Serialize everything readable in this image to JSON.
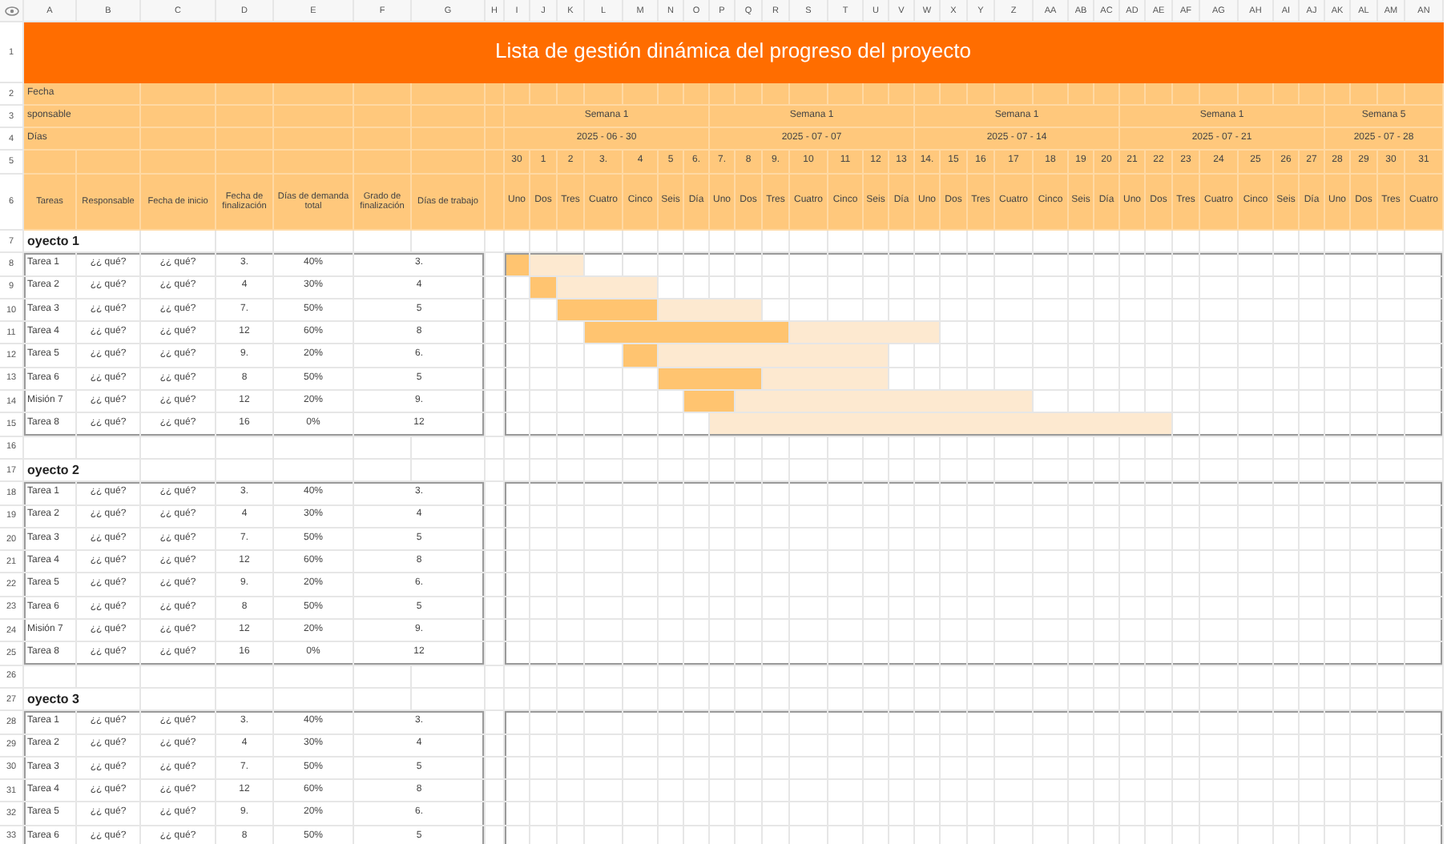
{
  "columns": [
    "A",
    "B",
    "C",
    "D",
    "E",
    "F",
    "G",
    "H",
    "I",
    "J",
    "K",
    "L",
    "M",
    "N",
    "O",
    "P",
    "Q",
    "R",
    "S",
    "T",
    "U",
    "V",
    "W",
    "X",
    "Y",
    "Z",
    "AA",
    "AB",
    "AC",
    "AD",
    "AE",
    "AF",
    "AG",
    "AH",
    "AI",
    "AJ",
    "AK",
    "AL",
    "AM",
    "AN"
  ],
  "row_numbers": [
    "1",
    "2",
    "3",
    "4",
    "5",
    "6",
    "7",
    "8",
    "9",
    "10",
    "11",
    "12",
    "13",
    "14",
    "15",
    "16",
    "17",
    "18",
    "19",
    "20",
    "21",
    "22",
    "23",
    "24",
    "25",
    "26",
    "27",
    "28",
    "29",
    "30",
    "31",
    "32",
    "33"
  ],
  "title": "Lista de gestión dinámica del progreso del proyecto",
  "labels": [
    "Fecha",
    "sponsable",
    "Días"
  ],
  "weeks": [
    {
      "label": "Semana 1",
      "date": "2025 - 06 - 30"
    },
    {
      "label": "Semana 1",
      "date": "2025 - 07 - 07"
    },
    {
      "label": "Semana 1",
      "date": "2025 - 07 - 14"
    },
    {
      "label": "Semana 1",
      "date": "2025 - 07 - 21"
    },
    {
      "label": "Semana 5",
      "date": "2025 - 07 - 28"
    }
  ],
  "days": [
    {
      "number": "30",
      "weekday": "Uno"
    },
    {
      "number": "1",
      "weekday": "Dos"
    },
    {
      "number": "2",
      "weekday": "Tres"
    },
    {
      "number": "3.",
      "weekday": "Cuatro"
    },
    {
      "number": "4",
      "weekday": "Cinco"
    },
    {
      "number": "5",
      "weekday": "Seis"
    },
    {
      "number": "6.",
      "weekday": "Día"
    },
    {
      "number": "7.",
      "weekday": "Uno"
    },
    {
      "number": "8",
      "weekday": "Dos"
    },
    {
      "number": "9.",
      "weekday": "Tres"
    },
    {
      "number": "10",
      "weekday": "Cuatro"
    },
    {
      "number": "11",
      "weekday": "Cinco"
    },
    {
      "number": "12",
      "weekday": "Seis"
    },
    {
      "number": "13",
      "weekday": "Día"
    },
    {
      "number": "14.",
      "weekday": "Uno"
    },
    {
      "number": "15",
      "weekday": "Dos"
    },
    {
      "number": "16",
      "weekday": "Tres"
    },
    {
      "number": "17",
      "weekday": "Cuatro"
    },
    {
      "number": "18",
      "weekday": "Cinco"
    },
    {
      "number": "19",
      "weekday": "Seis"
    },
    {
      "number": "20",
      "weekday": "Día"
    },
    {
      "number": "21",
      "weekday": "Uno"
    },
    {
      "number": "22",
      "weekday": "Dos"
    },
    {
      "number": "23",
      "weekday": "Tres"
    },
    {
      "number": "24",
      "weekday": "Cuatro"
    },
    {
      "number": "25",
      "weekday": "Cinco"
    },
    {
      "number": "26",
      "weekday": "Seis"
    },
    {
      "number": "27",
      "weekday": "Día"
    },
    {
      "number": "28",
      "weekday": "Uno"
    },
    {
      "number": "29",
      "weekday": "Dos"
    },
    {
      "number": "30",
      "weekday": "Tres"
    },
    {
      "number": "31",
      "weekday": "Cuatro"
    }
  ],
  "table_headers": [
    "Tareas",
    "Responsable",
    "Fecha de inicio",
    "Fecha de finalización",
    "Días de demanda total",
    "Grado de finalización",
    "Días de trabajo"
  ],
  "projects": [
    {
      "name": "oyecto 1",
      "tasks": [
        {
          "name": "Tarea 1",
          "responsible": "¿¿ qué?",
          "start": "¿¿ qué?",
          "end": "3.",
          "total": "40%",
          "workdays": "3.",
          "gantt": [
            {
              "kind": "done"
            },
            {
              "kind": "planned"
            },
            {
              "kind": "planned"
            }
          ]
        },
        {
          "name": "Tarea 2",
          "responsible": "¿¿ qué?",
          "start": "¿¿ qué?",
          "end": "4",
          "total": "30%",
          "workdays": "4",
          "gantt": [
            {
              "kind": "empty"
            },
            {
              "kind": "done"
            },
            {
              "kind": "planned"
            },
            {
              "kind": "planned"
            },
            {
              "kind": "planned"
            }
          ]
        },
        {
          "name": "Tarea 3",
          "responsible": "¿¿ qué?",
          "start": "¿¿ qué?",
          "end": "7.",
          "total": "50%",
          "workdays": "5",
          "gantt": [
            {
              "kind": "empty"
            },
            {
              "kind": "empty"
            },
            {
              "kind": "done"
            },
            {
              "kind": "done"
            },
            {
              "kind": "done"
            },
            {
              "kind": "planned"
            },
            {
              "kind": "planned"
            },
            {
              "kind": "planned"
            },
            {
              "kind": "planned"
            }
          ]
        },
        {
          "name": "Tarea 4",
          "responsible": "¿¿ qué?",
          "start": "¿¿ qué?",
          "end": "12",
          "total": "60%",
          "workdays": "8",
          "gantt": [
            {
              "kind": "empty"
            },
            {
              "kind": "empty"
            },
            {
              "kind": "empty"
            },
            {
              "kind": "done"
            },
            {
              "kind": "done"
            },
            {
              "kind": "done"
            },
            {
              "kind": "done"
            },
            {
              "kind": "done"
            },
            {
              "kind": "done"
            },
            {
              "kind": "done"
            },
            {
              "kind": "planned"
            },
            {
              "kind": "planned"
            },
            {
              "kind": "planned"
            },
            {
              "kind": "planned"
            },
            {
              "kind": "planned"
            }
          ]
        },
        {
          "name": "Tarea 5",
          "responsible": "¿¿ qué?",
          "start": "¿¿ qué?",
          "end": "9.",
          "total": "20%",
          "workdays": "6.",
          "gantt": [
            {
              "kind": "empty"
            },
            {
              "kind": "empty"
            },
            {
              "kind": "empty"
            },
            {
              "kind": "empty"
            },
            {
              "kind": "done"
            },
            {
              "kind": "planned"
            },
            {
              "kind": "planned"
            },
            {
              "kind": "planned"
            },
            {
              "kind": "planned"
            },
            {
              "kind": "planned"
            },
            {
              "kind": "planned"
            },
            {
              "kind": "planned"
            },
            {
              "kind": "planned"
            }
          ]
        },
        {
          "name": "Tarea 6",
          "responsible": "¿¿ qué?",
          "start": "¿¿ qué?",
          "end": "8",
          "total": "50%",
          "workdays": "5",
          "gantt": [
            {
              "kind": "empty"
            },
            {
              "kind": "empty"
            },
            {
              "kind": "empty"
            },
            {
              "kind": "empty"
            },
            {
              "kind": "empty"
            },
            {
              "kind": "done"
            },
            {
              "kind": "done"
            },
            {
              "kind": "done"
            },
            {
              "kind": "done"
            },
            {
              "kind": "planned"
            },
            {
              "kind": "planned"
            },
            {
              "kind": "planned"
            },
            {
              "kind": "planned"
            }
          ]
        },
        {
          "name": "Misión 7",
          "responsible": "¿¿ qué?",
          "start": "¿¿ qué?",
          "end": "12",
          "total": "20%",
          "workdays": "9.",
          "gantt": [
            {
              "kind": "empty"
            },
            {
              "kind": "empty"
            },
            {
              "kind": "empty"
            },
            {
              "kind": "empty"
            },
            {
              "kind": "empty"
            },
            {
              "kind": "empty"
            },
            {
              "kind": "done"
            },
            {
              "kind": "done"
            },
            {
              "kind": "planned"
            },
            {
              "kind": "planned"
            },
            {
              "kind": "planned"
            },
            {
              "kind": "planned"
            },
            {
              "kind": "planned"
            },
            {
              "kind": "planned"
            },
            {
              "kind": "planned"
            },
            {
              "kind": "planned"
            },
            {
              "kind": "planned"
            },
            {
              "kind": "planned"
            }
          ]
        },
        {
          "name": "Tarea 8",
          "responsible": "¿¿ qué?",
          "start": "¿¿ qué?",
          "end": "16",
          "total": "0%",
          "workdays": "12",
          "gantt": [
            {
              "kind": "empty"
            },
            {
              "kind": "empty"
            },
            {
              "kind": "empty"
            },
            {
              "kind": "empty"
            },
            {
              "kind": "empty"
            },
            {
              "kind": "empty"
            },
            {
              "kind": "empty"
            },
            {
              "kind": "planned"
            },
            {
              "kind": "planned"
            },
            {
              "kind": "planned"
            },
            {
              "kind": "planned"
            },
            {
              "kind": "planned"
            },
            {
              "kind": "planned"
            },
            {
              "kind": "planned"
            },
            {
              "kind": "planned"
            },
            {
              "kind": "planned"
            },
            {
              "kind": "planned"
            },
            {
              "kind": "planned"
            },
            {
              "kind": "planned"
            },
            {
              "kind": "planned"
            },
            {
              "kind": "planned"
            },
            {
              "kind": "planned"
            },
            {
              "kind": "planned"
            }
          ]
        }
      ]
    },
    {
      "name": "oyecto 2",
      "tasks": [
        {
          "name": "Tarea 1",
          "responsible": "¿¿ qué?",
          "start": "¿¿ qué?",
          "end": "3.",
          "total": "40%",
          "workdays": "3."
        },
        {
          "name": "Tarea 2",
          "responsible": "¿¿ qué?",
          "start": "¿¿ qué?",
          "end": "4",
          "total": "30%",
          "workdays": "4"
        },
        {
          "name": "Tarea 3",
          "responsible": "¿¿ qué?",
          "start": "¿¿ qué?",
          "end": "7.",
          "total": "50%",
          "workdays": "5"
        },
        {
          "name": "Tarea 4",
          "responsible": "¿¿ qué?",
          "start": "¿¿ qué?",
          "end": "12",
          "total": "60%",
          "workdays": "8"
        },
        {
          "name": "Tarea 5",
          "responsible": "¿¿ qué?",
          "start": "¿¿ qué?",
          "end": "9.",
          "total": "20%",
          "workdays": "6."
        },
        {
          "name": "Tarea 6",
          "responsible": "¿¿ qué?",
          "start": "¿¿ qué?",
          "end": "8",
          "total": "50%",
          "workdays": "5"
        },
        {
          "name": "Misión 7",
          "responsible": "¿¿ qué?",
          "start": "¿¿ qué?",
          "end": "12",
          "total": "20%",
          "workdays": "9."
        },
        {
          "name": "Tarea 8",
          "responsible": "¿¿ qué?",
          "start": "¿¿ qué?",
          "end": "16",
          "total": "0%",
          "workdays": "12"
        }
      ]
    },
    {
      "name": "oyecto 3",
      "tasks": [
        {
          "name": "Tarea 1",
          "responsible": "¿¿ qué?",
          "start": "¿¿ qué?",
          "end": "3.",
          "total": "40%",
          "workdays": "3."
        },
        {
          "name": "Tarea 2",
          "responsible": "¿¿ qué?",
          "start": "¿¿ qué?",
          "end": "4",
          "total": "30%",
          "workdays": "4"
        },
        {
          "name": "Tarea 3",
          "responsible": "¿¿ qué?",
          "start": "¿¿ qué?",
          "end": "7.",
          "total": "50%",
          "workdays": "5"
        },
        {
          "name": "Tarea 4",
          "responsible": "¿¿ qué?",
          "start": "¿¿ qué?",
          "end": "12",
          "total": "60%",
          "workdays": "8"
        },
        {
          "name": "Tarea 5",
          "responsible": "¿¿ qué?",
          "start": "¿¿ qué?",
          "end": "9.",
          "total": "20%",
          "workdays": "6."
        },
        {
          "name": "Tarea 6",
          "responsible": "¿¿ qué?",
          "start": "¿¿ qué?",
          "end": "8",
          "total": "50%",
          "workdays": "5"
        }
      ]
    }
  ]
}
